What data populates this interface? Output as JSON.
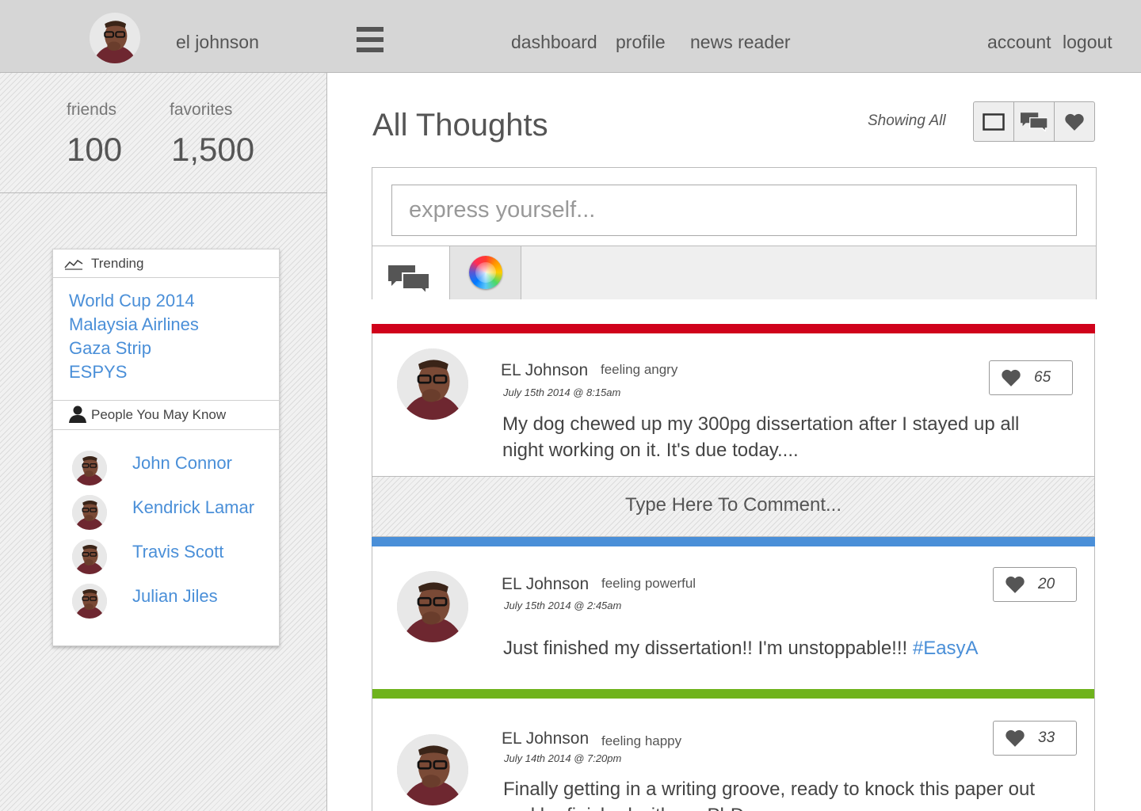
{
  "header": {
    "username": "el johnson",
    "nav": [
      "dashboard",
      "profile",
      "news reader"
    ],
    "account": "account",
    "logout": "logout"
  },
  "stats": {
    "friends_label": "friends",
    "friends_value": "100",
    "favorites_label": "favorites",
    "favorites_value": "1,500"
  },
  "trending": {
    "title": "Trending",
    "items": [
      "World Cup 2014",
      "Malaysia Airlines",
      "Gaza Strip",
      "ESPYS"
    ]
  },
  "people": {
    "title": "People You May Know",
    "items": [
      "John Connor",
      "Kendrick Lamar",
      "Travis Scott",
      "Julian Jiles"
    ]
  },
  "main": {
    "title": "All Thoughts",
    "filter_label": "Showing All"
  },
  "composer": {
    "placeholder": "express yourself..."
  },
  "comment_placeholder": "Type Here To Comment...",
  "posts": [
    {
      "author": "EL Johnson",
      "mood": "feeling angry",
      "date": "July 15th 2014 @ 8:15am",
      "text": "My dog chewed up my 300pg dissertation after I stayed up all night working on it. It's due today....",
      "likes": "65",
      "color": "#d0021b"
    },
    {
      "author": "EL Johnson",
      "mood": "feeling powerful",
      "date": "July 15th 2014 @ 2:45am",
      "text": "Just finished my dissertation!! I'm unstoppable!!!",
      "hashtag": "#EasyA",
      "likes": "20",
      "color": "#4a8fd8"
    },
    {
      "author": "EL Johnson",
      "mood": "feeling happy",
      "date": "July 14th 2014 @ 7:20pm",
      "text": "Finally getting in a writing groove, ready to knock this paper out and be finished with my PhD",
      "likes": "33",
      "color": "#6fb31c"
    }
  ]
}
